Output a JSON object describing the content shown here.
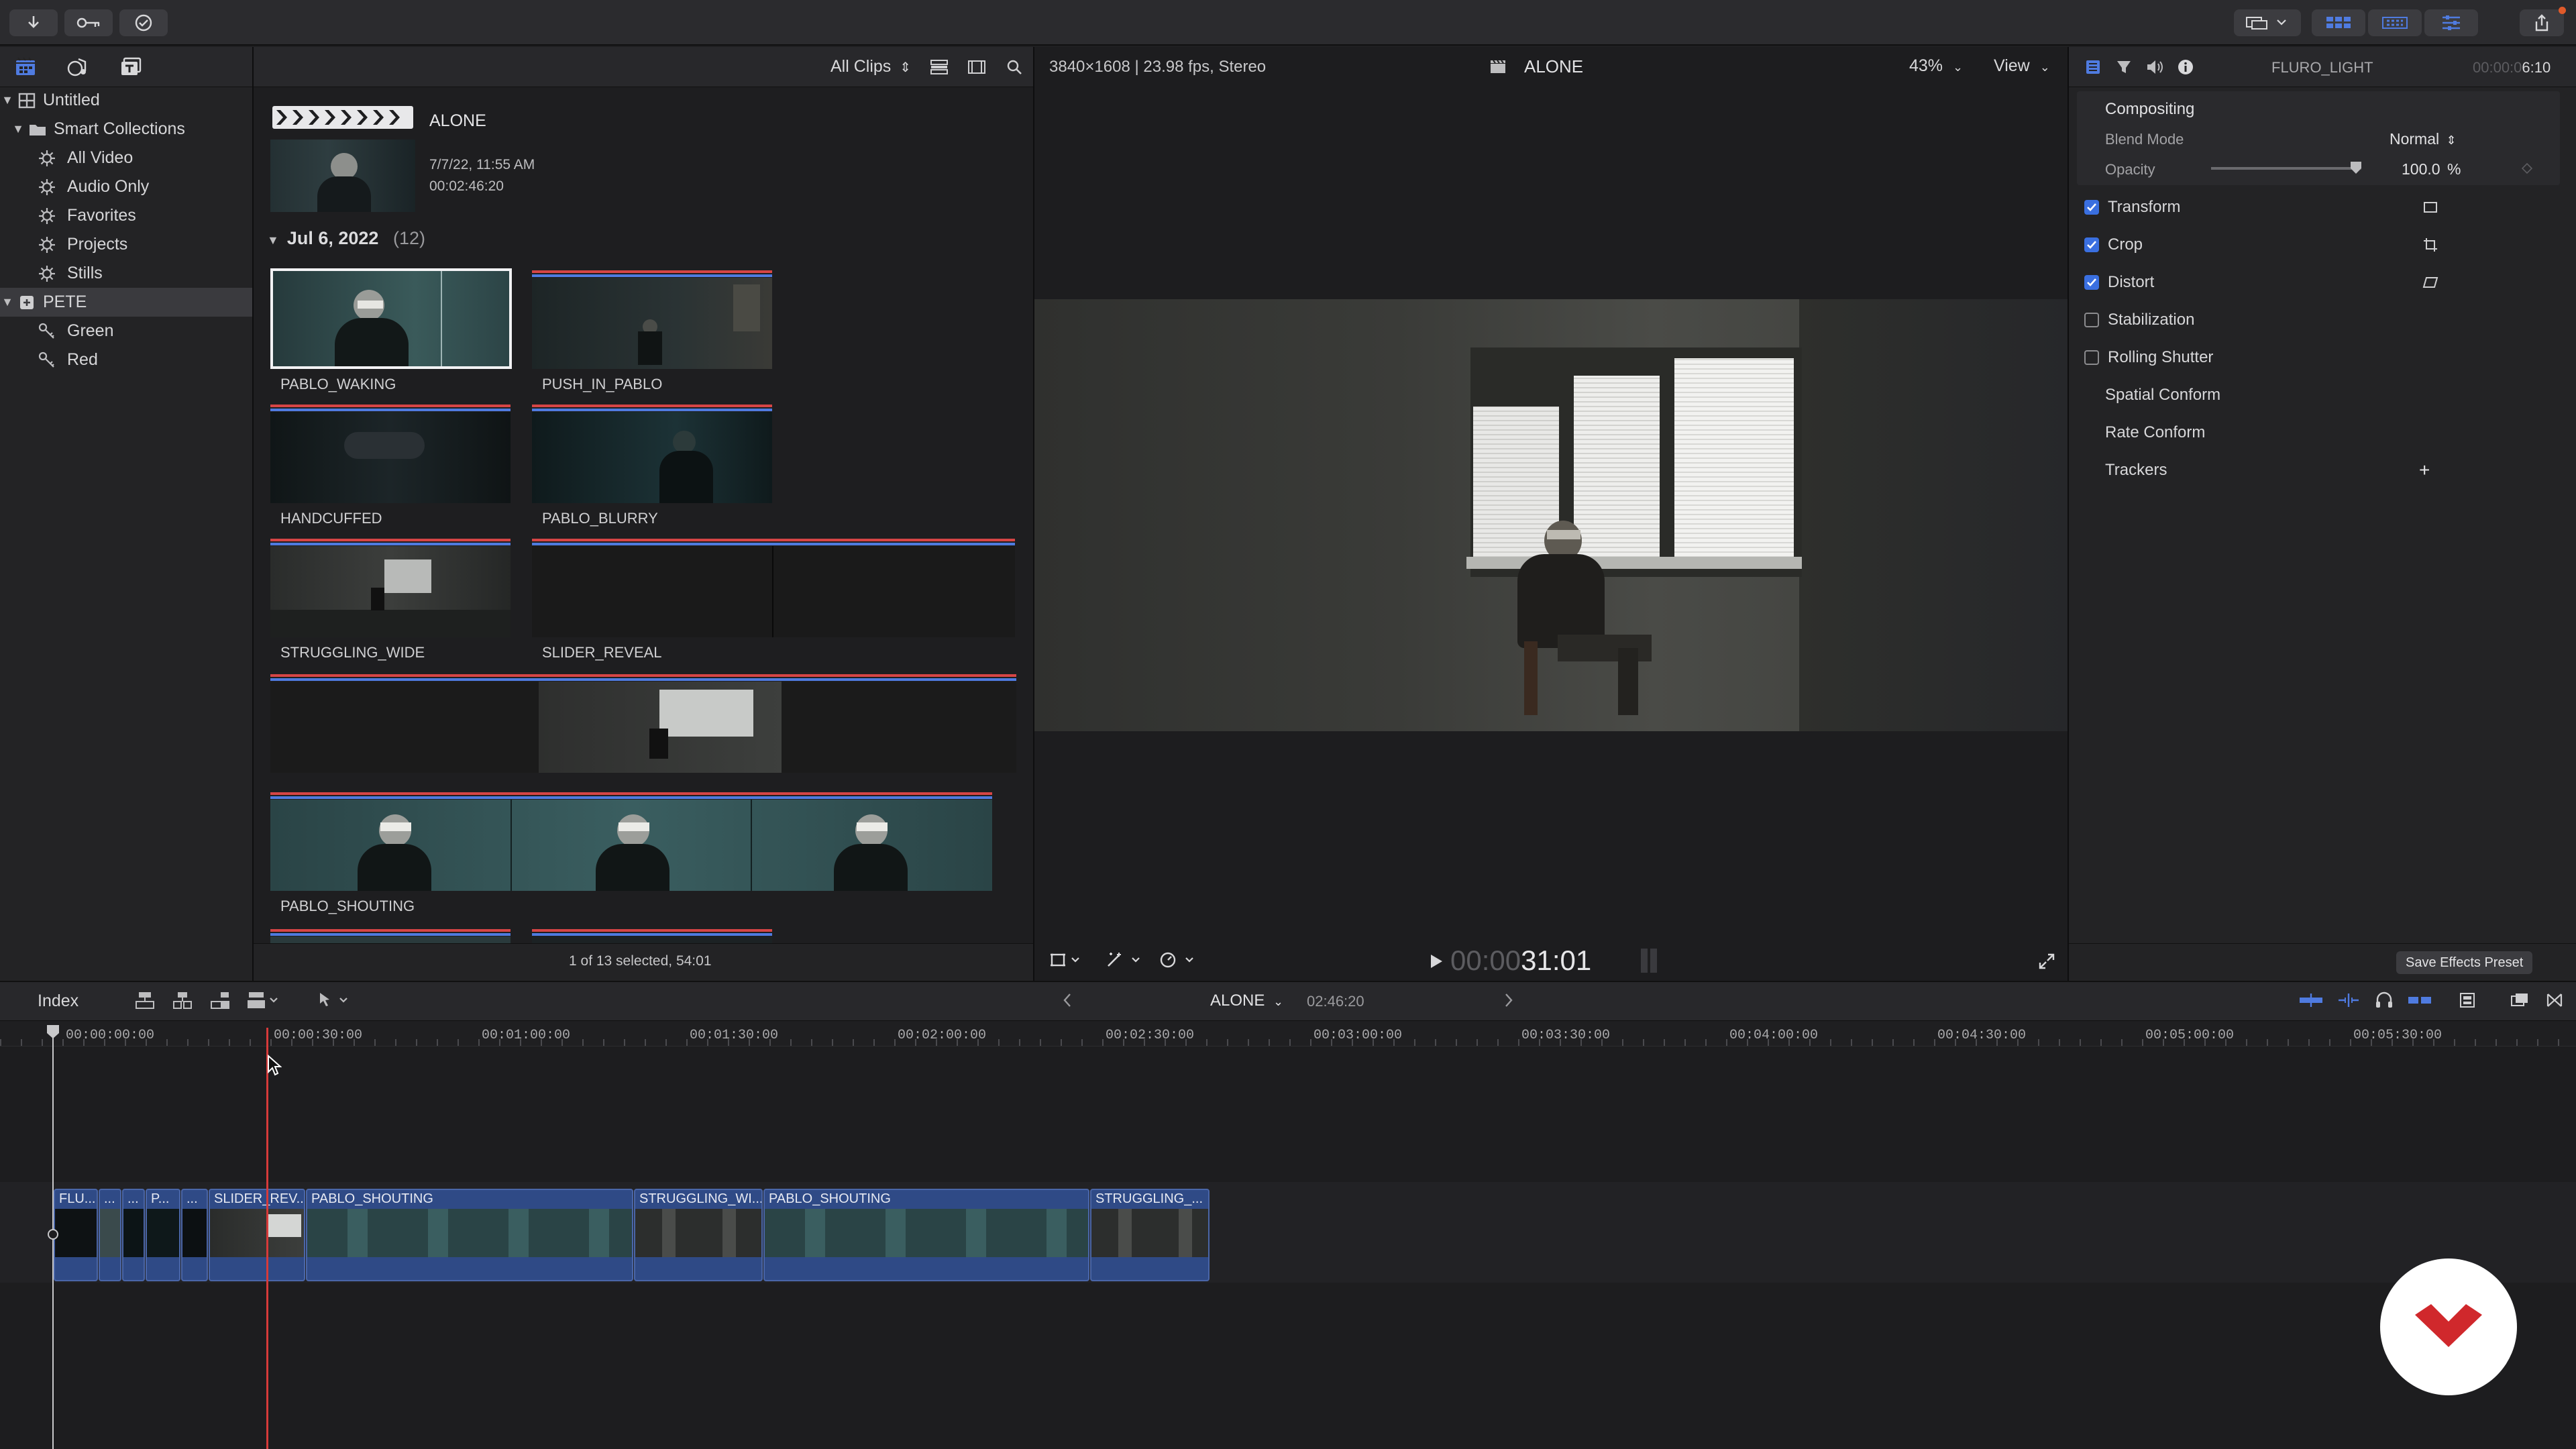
{
  "colors": {
    "accent": "#3a6fe0",
    "playhead_red": "#d63a3a",
    "clip_blue": "#2f4a86",
    "audio_red": "#d64545",
    "logo_red": "#d0282c"
  },
  "toolbar": {
    "left_icons": [
      "import-icon",
      "keywords-icon",
      "background-tasks-icon"
    ],
    "right_icons": [
      "media-import-icon",
      "libraries-toggle-icon",
      "browser-toggle-icon",
      "timeline-toggle-icon",
      "inspector-toggle-icon",
      "share-icon"
    ]
  },
  "library": {
    "root": "Untitled",
    "smart_collections": "Smart Collections",
    "items": [
      {
        "label": "All Video"
      },
      {
        "label": "Audio Only"
      },
      {
        "label": "Favorites"
      },
      {
        "label": "Projects"
      },
      {
        "label": "Stills"
      }
    ],
    "event": "PETE",
    "keywords": [
      {
        "label": "Green"
      },
      {
        "label": "Red"
      }
    ]
  },
  "browser": {
    "filter": "All Clips",
    "project_name": "ALONE",
    "project_date": "7/7/22, 11:55 AM",
    "project_duration": "00:02:46:20",
    "group_date": "Jul 6, 2022",
    "group_count": "(12)",
    "clips": [
      {
        "label": "PABLO_WAKING"
      },
      {
        "label": "PUSH_IN_PABLO"
      },
      {
        "label": "HANDCUFFED"
      },
      {
        "label": "PABLO_BLURRY"
      },
      {
        "label": "STRUGGLING_WIDE"
      },
      {
        "label": "SLIDER_REVEAL"
      },
      {
        "label": "PABLO_SHOUTING"
      }
    ],
    "status": "1 of 13 selected, 54:01"
  },
  "viewer": {
    "format": "3840×1608 | 23.98 fps, Stereo",
    "title": "ALONE",
    "zoom": "43%",
    "view_label": "View",
    "timecode_dim": "00:00",
    "timecode": "31:01"
  },
  "inspector": {
    "clip_name": "FLURO_LIGHT",
    "duration_dim": "00:00:0",
    "duration": "6:10",
    "compositing": "Compositing",
    "blend_mode_label": "Blend Mode",
    "blend_mode_value": "Normal",
    "opacity_label": "Opacity",
    "opacity_value": "100.0",
    "opacity_unit": "%",
    "opacity_fraction": 1.0,
    "rows": [
      {
        "label": "Transform",
        "checked": true
      },
      {
        "label": "Crop",
        "checked": true
      },
      {
        "label": "Distort",
        "checked": true
      },
      {
        "label": "Stabilization",
        "checked": false
      },
      {
        "label": "Rolling Shutter",
        "checked": false
      },
      {
        "label": "Spatial Conform"
      },
      {
        "label": "Rate Conform"
      },
      {
        "label": "Trackers"
      }
    ],
    "trackers_add": "+",
    "save_preset": "Save Effects Preset"
  },
  "timeline": {
    "index_label": "Index",
    "project": "ALONE",
    "duration": "02:46:20",
    "ruler": [
      "00:00:00:00",
      "00:00:30:00",
      "00:01:00:00",
      "00:01:30:00",
      "00:02:00:00",
      "00:02:30:00",
      "00:03:00:00",
      "00:03:30:00",
      "00:04:00:00",
      "00:04:30:00",
      "00:05:00:00",
      "00:05:30:00"
    ],
    "clips": [
      {
        "label": "FLU..."
      },
      {
        "label": "..."
      },
      {
        "label": "..."
      },
      {
        "label": "P..."
      },
      {
        "label": "..."
      },
      {
        "label": "SLIDER_REV..."
      },
      {
        "label": "PABLO_SHOUTING"
      },
      {
        "label": "STRUGGLING_WI..."
      },
      {
        "label": "PABLO_SHOUTING"
      },
      {
        "label": "STRUGGLING_..."
      }
    ]
  }
}
